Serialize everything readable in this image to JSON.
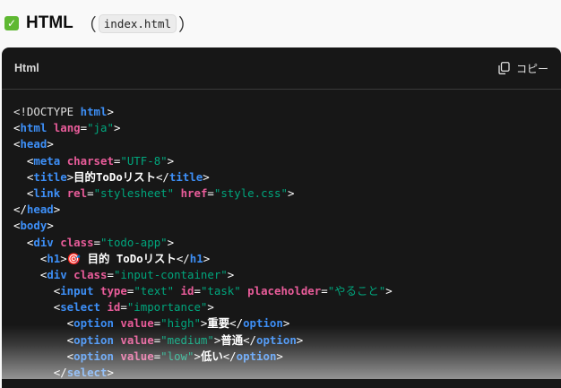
{
  "heading": {
    "title": "HTML",
    "paren_open": "（",
    "filename": "index.html",
    "paren_close": "）"
  },
  "code_block": {
    "language": "Html",
    "copy_label": "コピー",
    "copy_icon": "copy-icon",
    "lines": [
      [
        {
          "c": "doc",
          "t": "<!DOCTYPE "
        },
        {
          "c": "tag",
          "t": "html"
        },
        {
          "c": "p",
          "t": ">"
        }
      ],
      [
        {
          "c": "p",
          "t": "<"
        },
        {
          "c": "tag",
          "t": "html"
        },
        {
          "c": "p",
          "t": " "
        },
        {
          "c": "attr",
          "t": "lang"
        },
        {
          "c": "p",
          "t": "="
        },
        {
          "c": "val",
          "t": "\"ja\""
        },
        {
          "c": "p",
          "t": ">"
        }
      ],
      [
        {
          "c": "p",
          "t": "<"
        },
        {
          "c": "tag",
          "t": "head"
        },
        {
          "c": "p",
          "t": ">"
        }
      ],
      [
        {
          "c": "p",
          "t": "  <"
        },
        {
          "c": "tag",
          "t": "meta"
        },
        {
          "c": "p",
          "t": " "
        },
        {
          "c": "attr",
          "t": "charset"
        },
        {
          "c": "p",
          "t": "="
        },
        {
          "c": "val",
          "t": "\"UTF-8\""
        },
        {
          "c": "p",
          "t": ">"
        }
      ],
      [
        {
          "c": "p",
          "t": "  <"
        },
        {
          "c": "tag",
          "t": "title"
        },
        {
          "c": "p",
          "t": ">"
        },
        {
          "c": "txt",
          "t": "目的ToDoリスト"
        },
        {
          "c": "p",
          "t": "</"
        },
        {
          "c": "tag",
          "t": "title"
        },
        {
          "c": "p",
          "t": ">"
        }
      ],
      [
        {
          "c": "p",
          "t": "  <"
        },
        {
          "c": "tag",
          "t": "link"
        },
        {
          "c": "p",
          "t": " "
        },
        {
          "c": "attr",
          "t": "rel"
        },
        {
          "c": "p",
          "t": "="
        },
        {
          "c": "val",
          "t": "\"stylesheet\""
        },
        {
          "c": "p",
          "t": " "
        },
        {
          "c": "attr",
          "t": "href"
        },
        {
          "c": "p",
          "t": "="
        },
        {
          "c": "val",
          "t": "\"style.css\""
        },
        {
          "c": "p",
          "t": ">"
        }
      ],
      [
        {
          "c": "p",
          "t": "</"
        },
        {
          "c": "tag",
          "t": "head"
        },
        {
          "c": "p",
          "t": ">"
        }
      ],
      [
        {
          "c": "p",
          "t": "<"
        },
        {
          "c": "tag",
          "t": "body"
        },
        {
          "c": "p",
          "t": ">"
        }
      ],
      [
        {
          "c": "p",
          "t": "  <"
        },
        {
          "c": "tag",
          "t": "div"
        },
        {
          "c": "p",
          "t": " "
        },
        {
          "c": "attr",
          "t": "class"
        },
        {
          "c": "p",
          "t": "="
        },
        {
          "c": "val",
          "t": "\"todo-app\""
        },
        {
          "c": "p",
          "t": ">"
        }
      ],
      [
        {
          "c": "p",
          "t": "    <"
        },
        {
          "c": "tag",
          "t": "h1"
        },
        {
          "c": "p",
          "t": ">"
        },
        {
          "c": "txt",
          "t": "🎯 目的 ToDoリスト"
        },
        {
          "c": "p",
          "t": "</"
        },
        {
          "c": "tag",
          "t": "h1"
        },
        {
          "c": "p",
          "t": ">"
        }
      ],
      [
        {
          "c": "p",
          "t": "    <"
        },
        {
          "c": "tag",
          "t": "div"
        },
        {
          "c": "p",
          "t": " "
        },
        {
          "c": "attr",
          "t": "class"
        },
        {
          "c": "p",
          "t": "="
        },
        {
          "c": "val",
          "t": "\"input-container\""
        },
        {
          "c": "p",
          "t": ">"
        }
      ],
      [
        {
          "c": "p",
          "t": "      <"
        },
        {
          "c": "tag",
          "t": "input"
        },
        {
          "c": "p",
          "t": " "
        },
        {
          "c": "attr",
          "t": "type"
        },
        {
          "c": "p",
          "t": "="
        },
        {
          "c": "val",
          "t": "\"text\""
        },
        {
          "c": "p",
          "t": " "
        },
        {
          "c": "attr",
          "t": "id"
        },
        {
          "c": "p",
          "t": "="
        },
        {
          "c": "val",
          "t": "\"task\""
        },
        {
          "c": "p",
          "t": " "
        },
        {
          "c": "attr",
          "t": "placeholder"
        },
        {
          "c": "p",
          "t": "="
        },
        {
          "c": "val",
          "t": "\"やること\""
        },
        {
          "c": "p",
          "t": ">"
        }
      ],
      [
        {
          "c": "p",
          "t": "      <"
        },
        {
          "c": "tag",
          "t": "select"
        },
        {
          "c": "p",
          "t": " "
        },
        {
          "c": "attr",
          "t": "id"
        },
        {
          "c": "p",
          "t": "="
        },
        {
          "c": "val",
          "t": "\"importance\""
        },
        {
          "c": "p",
          "t": ">"
        }
      ],
      [
        {
          "c": "p",
          "t": "        <"
        },
        {
          "c": "tag",
          "t": "option"
        },
        {
          "c": "p",
          "t": " "
        },
        {
          "c": "attr",
          "t": "value"
        },
        {
          "c": "p",
          "t": "="
        },
        {
          "c": "val",
          "t": "\"high\""
        },
        {
          "c": "p",
          "t": ">"
        },
        {
          "c": "txt",
          "t": "重要"
        },
        {
          "c": "p",
          "t": "</"
        },
        {
          "c": "tag",
          "t": "option"
        },
        {
          "c": "p",
          "t": ">"
        }
      ],
      [
        {
          "c": "p",
          "t": "        <"
        },
        {
          "c": "tag",
          "t": "option"
        },
        {
          "c": "p",
          "t": " "
        },
        {
          "c": "attr",
          "t": "value"
        },
        {
          "c": "p",
          "t": "="
        },
        {
          "c": "val",
          "t": "\"medium\""
        },
        {
          "c": "p",
          "t": ">"
        },
        {
          "c": "txt",
          "t": "普通"
        },
        {
          "c": "p",
          "t": "</"
        },
        {
          "c": "tag",
          "t": "option"
        },
        {
          "c": "p",
          "t": ">"
        }
      ],
      [
        {
          "c": "p",
          "t": "        <"
        },
        {
          "c": "tag",
          "t": "option"
        },
        {
          "c": "p",
          "t": " "
        },
        {
          "c": "attr",
          "t": "value"
        },
        {
          "c": "p",
          "t": "="
        },
        {
          "c": "val",
          "t": "\"low\""
        },
        {
          "c": "p",
          "t": ">"
        },
        {
          "c": "txt",
          "t": "低い"
        },
        {
          "c": "p",
          "t": "</"
        },
        {
          "c": "tag",
          "t": "option"
        },
        {
          "c": "p",
          "t": ">"
        }
      ],
      [
        {
          "c": "p",
          "t": "      </"
        },
        {
          "c": "tag",
          "t": "select"
        },
        {
          "c": "p",
          "t": ">"
        }
      ]
    ]
  }
}
